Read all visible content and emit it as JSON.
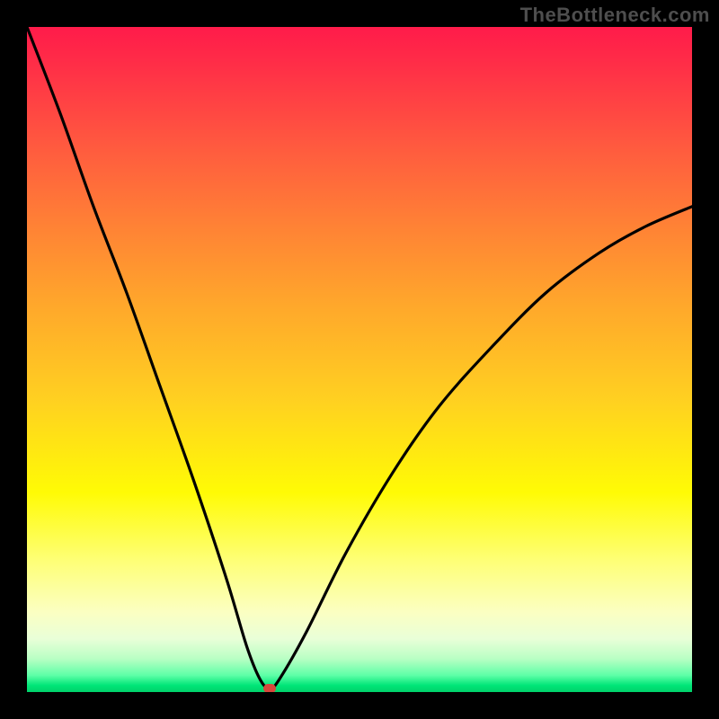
{
  "watermark": "TheBottleneck.com",
  "colors": {
    "frame": "#000000",
    "curve": "#000000",
    "marker": "#d9473b",
    "gradient_top": "#ff1b4a",
    "gradient_mid": "#fffb05",
    "gradient_bottom": "#00d26a"
  },
  "chart_data": {
    "type": "line",
    "title": "",
    "xlabel": "",
    "ylabel": "",
    "xlim": [
      0,
      100
    ],
    "ylim": [
      0,
      100
    ],
    "series": [
      {
        "name": "bottleneck-curve",
        "x": [
          0,
          5,
          10,
          15,
          20,
          25,
          30,
          33,
          35,
          36.5,
          38,
          42,
          48,
          55,
          62,
          70,
          78,
          86,
          93,
          100
        ],
        "values": [
          100,
          87,
          73,
          60,
          46,
          32,
          17,
          7,
          2,
          0.5,
          2,
          9,
          21,
          33,
          43,
          52,
          60,
          66,
          70,
          73
        ]
      }
    ],
    "annotations": [
      {
        "name": "optimal-marker",
        "x": 36.5,
        "y": 0.5
      }
    ],
    "grid": false,
    "legend": false
  }
}
